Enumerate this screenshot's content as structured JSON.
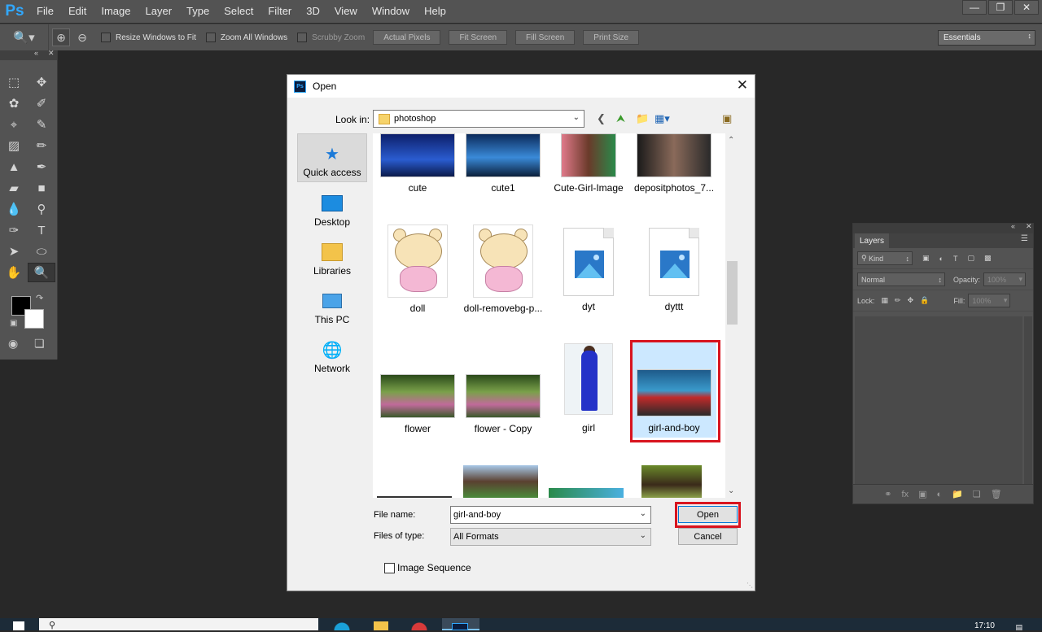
{
  "app": {
    "logo": "Ps",
    "menu": [
      "File",
      "Edit",
      "Image",
      "Layer",
      "Type",
      "Select",
      "Filter",
      "3D",
      "View",
      "Window",
      "Help"
    ],
    "window_controls": [
      "minimize",
      "restore",
      "close"
    ]
  },
  "options_bar": {
    "resize_windows": "Resize Windows to Fit",
    "zoom_all": "Zoom All Windows",
    "scrubby_zoom": "Scrubby Zoom",
    "actual_pixels": "Actual Pixels",
    "fit_screen": "Fit Screen",
    "fill_screen": "Fill Screen",
    "print_size": "Print Size",
    "workspace": "Essentials"
  },
  "layers_panel": {
    "tab": "Layers",
    "kind": "Kind",
    "blend_mode": "Normal",
    "opacity_label": "Opacity:",
    "opacity_value": "100%",
    "lock_label": "Lock:",
    "fill_label": "Fill:",
    "fill_value": "100%"
  },
  "dialog": {
    "title": "Open",
    "look_in_label": "Look in:",
    "look_in_value": "photoshop",
    "places": [
      "Quick access",
      "Desktop",
      "Libraries",
      "This PC",
      "Network"
    ],
    "files": [
      {
        "name": "cute",
        "kind": "image"
      },
      {
        "name": "cute1",
        "kind": "image"
      },
      {
        "name": "Cute-Girl-Image",
        "kind": "image"
      },
      {
        "name": "depositphotos_7...",
        "kind": "image"
      },
      {
        "name": "doll",
        "kind": "image"
      },
      {
        "name": "doll-removebg-p...",
        "kind": "image"
      },
      {
        "name": "dyt",
        "kind": "generic"
      },
      {
        "name": "dyttt",
        "kind": "generic"
      },
      {
        "name": "flower",
        "kind": "image"
      },
      {
        "name": "flower - Copy",
        "kind": "image"
      },
      {
        "name": "girl",
        "kind": "image"
      },
      {
        "name": "girl-and-boy",
        "kind": "image",
        "selected": true
      }
    ],
    "file_name_label": "File name:",
    "file_name_value": "girl-and-boy",
    "file_type_label": "Files of type:",
    "file_type_value": "All Formats",
    "open_button": "Open",
    "cancel_button": "Cancel",
    "image_sequence": "Image Sequence"
  },
  "taskbar": {
    "time": "17:10"
  }
}
